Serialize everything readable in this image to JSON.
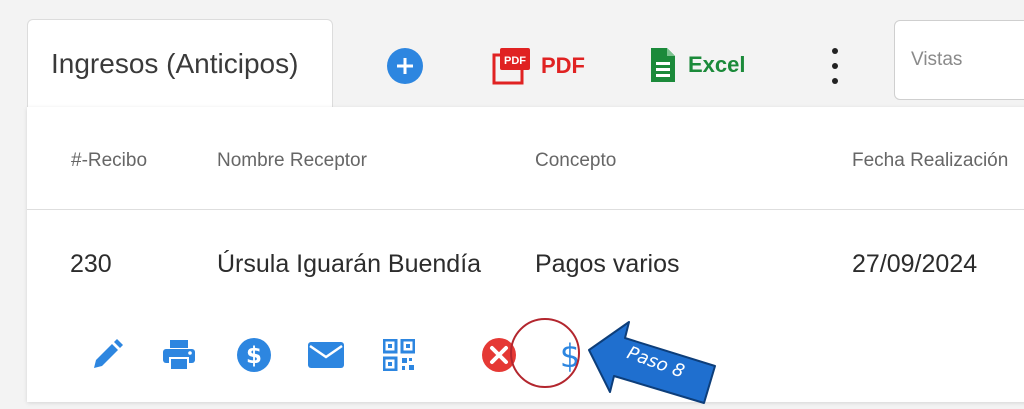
{
  "title_tab": {
    "label": "Ingresos (Anticipos)"
  },
  "toolbar": {
    "pdf_label": "PDF",
    "pdf_badge": "PDF",
    "excel_label": "Excel"
  },
  "views": {
    "placeholder": "Vistas"
  },
  "table": {
    "columns": [
      "#-Recibo",
      "Nombre Receptor",
      "Concepto",
      "Fecha Realización"
    ],
    "rows": [
      {
        "recibo": "230",
        "nombre": "Úrsula Iguarán Buendía",
        "concepto": "Pagos varios",
        "fecha": "27/09/2024"
      }
    ]
  },
  "actions": [
    "edit-icon",
    "print-icon",
    "payment-icon",
    "email-icon",
    "qr-code-icon",
    "cancel-icon",
    "dollar-icon"
  ],
  "annotation": {
    "step_label": "Paso 8"
  },
  "colors": {
    "accent_blue": "#2d86e0",
    "pdf_red": "#e02222",
    "excel_green": "#1b8a3a",
    "cancel_red": "#e53935",
    "ring_red": "#b3262e",
    "arrow_fill": "#1f6fcf"
  }
}
